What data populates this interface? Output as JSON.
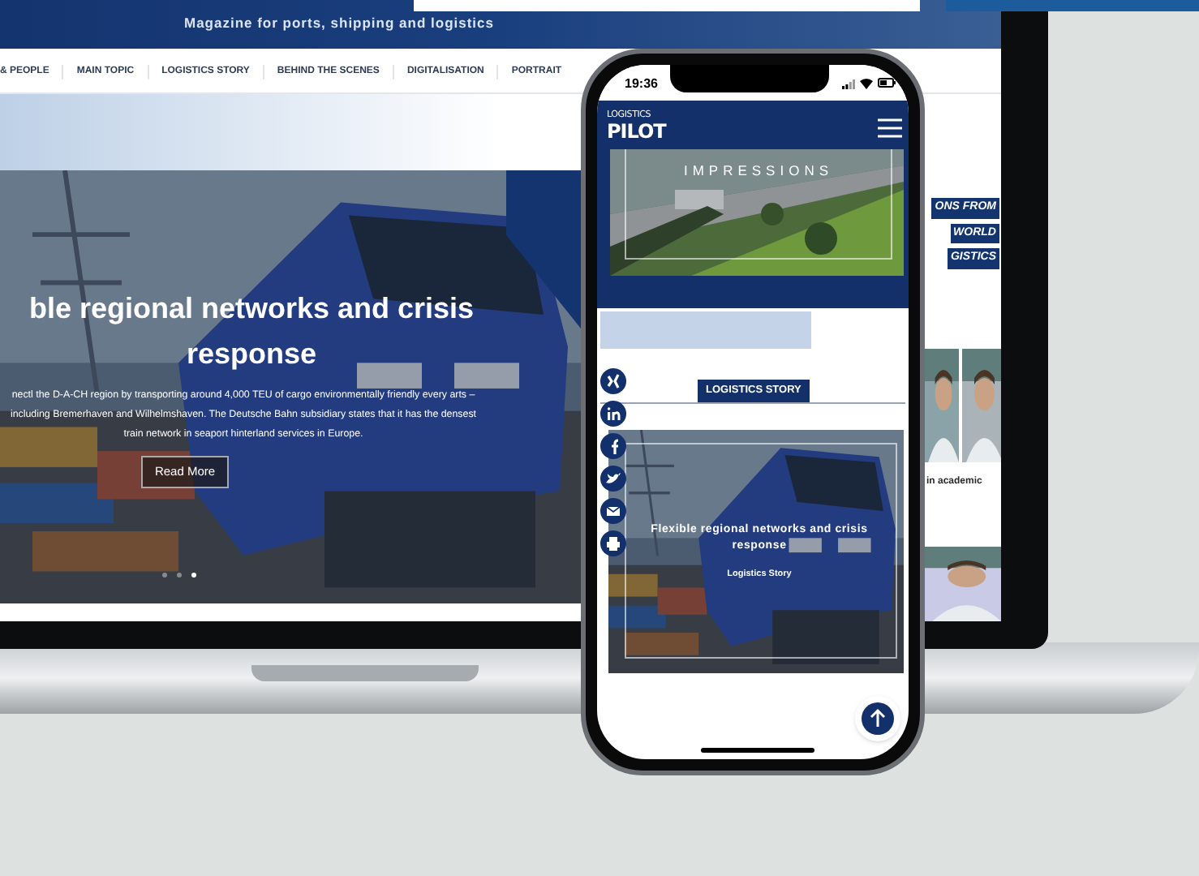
{
  "laptop": {
    "tagline": "Magazine for ports, shipping and logistics",
    "nav": [
      "& PEOPLE",
      "MAIN TOPIC",
      "LOGISTICS STORY",
      "BEHIND THE SCENES",
      "DIGITALISATION",
      "PORTRAIT"
    ],
    "hero": {
      "title": "ble regional networks and crisis response",
      "text": "nectl the D-A-CH region by transporting around 4,000 TEU of cargo environmentally friendly every arts – including Bremerhaven and Wilhelmshaven. The Deutsche Bahn subsidiary states that it has the densest train network in seaport hinterland services in Europe.",
      "button": "Read More",
      "dots": [
        {
          "selected": false
        },
        {
          "selected": false
        },
        {
          "selected": true
        }
      ]
    },
    "side": {
      "tags": [
        "ONS FROM",
        "WORLD",
        "GISTICS"
      ],
      "caption": "in academic"
    }
  },
  "phone": {
    "time": "19:36",
    "logo": [
      "LOGISTICS",
      "PILOT"
    ],
    "banner": "IMPRESSIONS",
    "section_label": "LOGISTICS STORY",
    "share": [
      {
        "kind": "xing"
      },
      {
        "kind": "linkedin"
      },
      {
        "kind": "facebook"
      },
      {
        "kind": "twitter"
      },
      {
        "kind": "mail"
      },
      {
        "kind": "print"
      }
    ],
    "card": {
      "title": "Flexible regional networks and crisis response",
      "category": "Logistics Story"
    }
  }
}
